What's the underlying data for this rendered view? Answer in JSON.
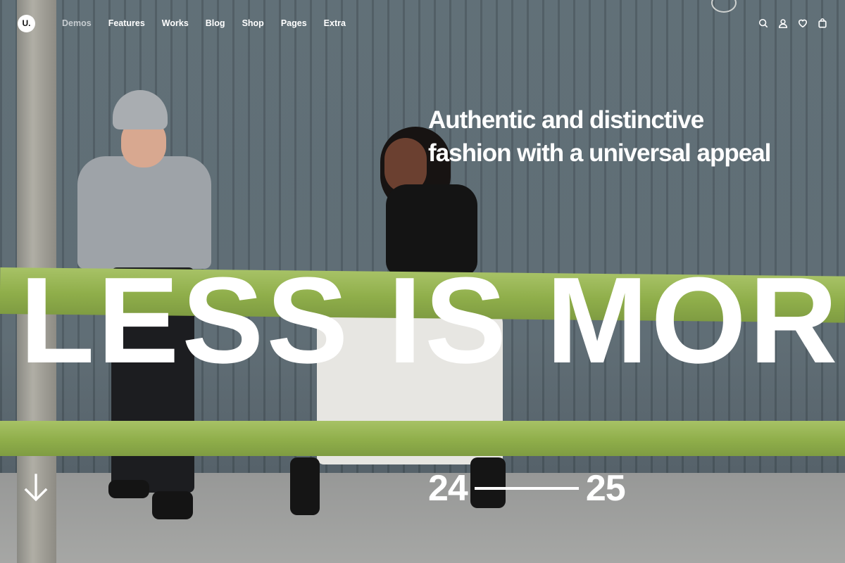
{
  "brand": {
    "logo_text": "U."
  },
  "nav": {
    "items": [
      {
        "label": "Demos",
        "active": true
      },
      {
        "label": "Features",
        "active": false
      },
      {
        "label": "Works",
        "active": false
      },
      {
        "label": "Blog",
        "active": false
      },
      {
        "label": "Shop",
        "active": false
      },
      {
        "label": "Pages",
        "active": false
      },
      {
        "label": "Extra",
        "active": false
      }
    ],
    "icons": [
      "search-icon",
      "user-icon",
      "heart-icon",
      "bag-icon"
    ]
  },
  "hero": {
    "tagline_line1": "Authentic and distinctive",
    "tagline_line2": "fashion with a universal appeal",
    "headline": "LESS IS MORE",
    "year_start": "24",
    "year_end": "25"
  },
  "colors": {
    "text": "#ffffff",
    "rail_green": "#8fae4a",
    "wall": "#5a6870"
  }
}
